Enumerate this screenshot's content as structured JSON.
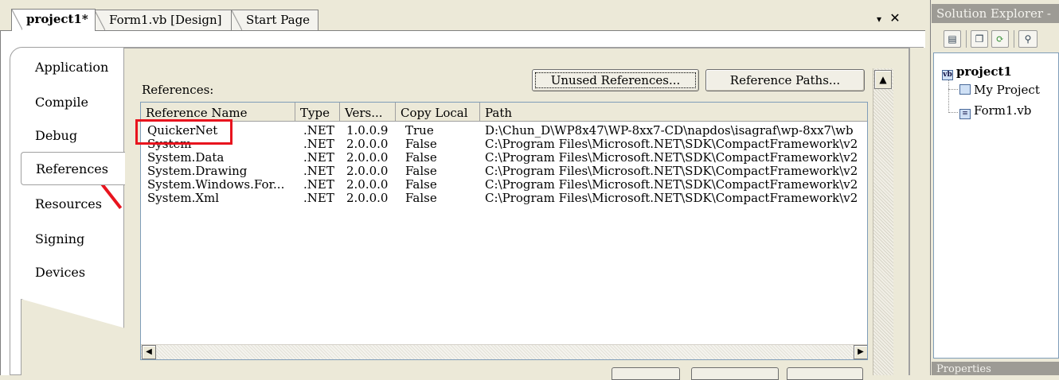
{
  "doc_tabs": [
    {
      "label": "project1*",
      "active": true
    },
    {
      "label": "Form1.vb [Design]",
      "active": false
    },
    {
      "label": "Start Page",
      "active": false
    }
  ],
  "window_controls": {
    "dropdown": "▾",
    "close": "✕"
  },
  "left_tabs": [
    {
      "label": "Application"
    },
    {
      "label": "Compile"
    },
    {
      "label": "Debug"
    },
    {
      "label": "References",
      "active": true
    },
    {
      "label": "Resources"
    },
    {
      "label": "Signing"
    },
    {
      "label": "Devices"
    }
  ],
  "references_page": {
    "label": "References:",
    "unused_button": "Unused References...",
    "paths_button": "Reference Paths...",
    "columns": [
      "Reference Name",
      "Type",
      "Vers...",
      "Copy Local",
      "Path"
    ],
    "rows": [
      {
        "name": "QuickerNet",
        "type": ".NET",
        "version": "1.0.0.9",
        "copy_local": "True",
        "path": "D:\\Chun_D\\WP8x47\\WP-8xx7-CD\\napdos\\isagraf\\wp-8xx7\\wb"
      },
      {
        "name": "System",
        "type": ".NET",
        "version": "2.0.0.0",
        "copy_local": "False",
        "path": "C:\\Program Files\\Microsoft.NET\\SDK\\CompactFramework\\v2"
      },
      {
        "name": "System.Data",
        "type": ".NET",
        "version": "2.0.0.0",
        "copy_local": "False",
        "path": "C:\\Program Files\\Microsoft.NET\\SDK\\CompactFramework\\v2"
      },
      {
        "name": "System.Drawing",
        "type": ".NET",
        "version": "2.0.0.0",
        "copy_local": "False",
        "path": "C:\\Program Files\\Microsoft.NET\\SDK\\CompactFramework\\v2"
      },
      {
        "name": "System.Windows.For...",
        "type": ".NET",
        "version": "2.0.0.0",
        "copy_local": "False",
        "path": "C:\\Program Files\\Microsoft.NET\\SDK\\CompactFramework\\v2"
      },
      {
        "name": "System.Xml",
        "type": ".NET",
        "version": "2.0.0.0",
        "copy_local": "False",
        "path": "C:\\Program Files\\Microsoft.NET\\SDK\\CompactFramework\\v2"
      }
    ],
    "highlight_color": "#e8141e"
  },
  "solution_explorer": {
    "title": "Solution Explorer -",
    "toolbar_icons": [
      "properties-icon",
      "show-all-files-icon",
      "refresh-icon",
      "view-class-diagram-icon"
    ],
    "tree": [
      {
        "label": "project1",
        "icon": "vb-project-icon",
        "bold": true
      },
      {
        "label": "My Project",
        "icon": "my-project-icon"
      },
      {
        "label": "Form1.vb",
        "icon": "form-icon"
      }
    ]
  },
  "properties_panel": {
    "title": "Properties"
  }
}
